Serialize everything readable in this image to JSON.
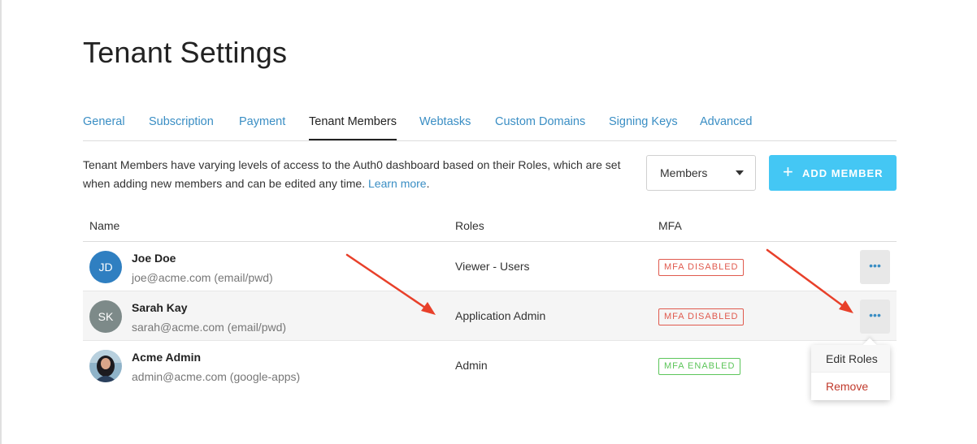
{
  "page": {
    "title": "Tenant Settings"
  },
  "tabs": [
    {
      "label": "General",
      "active": false
    },
    {
      "label": "Subscription",
      "active": false
    },
    {
      "label": "Payment",
      "active": false
    },
    {
      "label": "Tenant Members",
      "active": true
    },
    {
      "label": "Webtasks",
      "active": false
    },
    {
      "label": "Custom Domains",
      "active": false
    },
    {
      "label": "Signing Keys",
      "active": false
    },
    {
      "label": "Advanced",
      "active": false
    }
  ],
  "description": {
    "text": "Tenant Members have varying levels of access to the Auth0 dashboard based on their Roles, which are set when adding new members and can be edited any time.",
    "link": "Learn more",
    "after": "."
  },
  "filter": {
    "value": "Members"
  },
  "add_button": {
    "icon": "plus-icon",
    "label": "ADD MEMBER"
  },
  "table": {
    "headers": {
      "name": "Name",
      "roles": "Roles",
      "mfa": "MFA"
    },
    "rows": [
      {
        "initials": "JD",
        "name": "Joe Doe",
        "email": "joe@acme.com (email/pwd)",
        "role": "Viewer - Users",
        "mfa": "MFA DISABLED"
      },
      {
        "initials": "SK",
        "name": "Sarah Kay",
        "email": "sarah@acme.com (email/pwd)",
        "role": "Application Admin",
        "mfa": "MFA DISABLED"
      },
      {
        "initials": "",
        "name": "Acme Admin",
        "email": "admin@acme.com (google-apps)",
        "role": "Admin",
        "mfa": "MFA ENABLED"
      }
    ]
  },
  "more_button": {
    "glyph": "•••"
  },
  "context_menu": {
    "edit": "Edit Roles",
    "remove": "Remove"
  },
  "colors": {
    "accent": "#3a8ec4",
    "button": "#44c7f4",
    "mfa_disabled": "#e05a4e",
    "mfa_enabled": "#5cc55a",
    "annotation_arrow": "#e8402a",
    "avatar_joe": "#2f7fc1",
    "avatar_sarah": "#7d8a89"
  }
}
